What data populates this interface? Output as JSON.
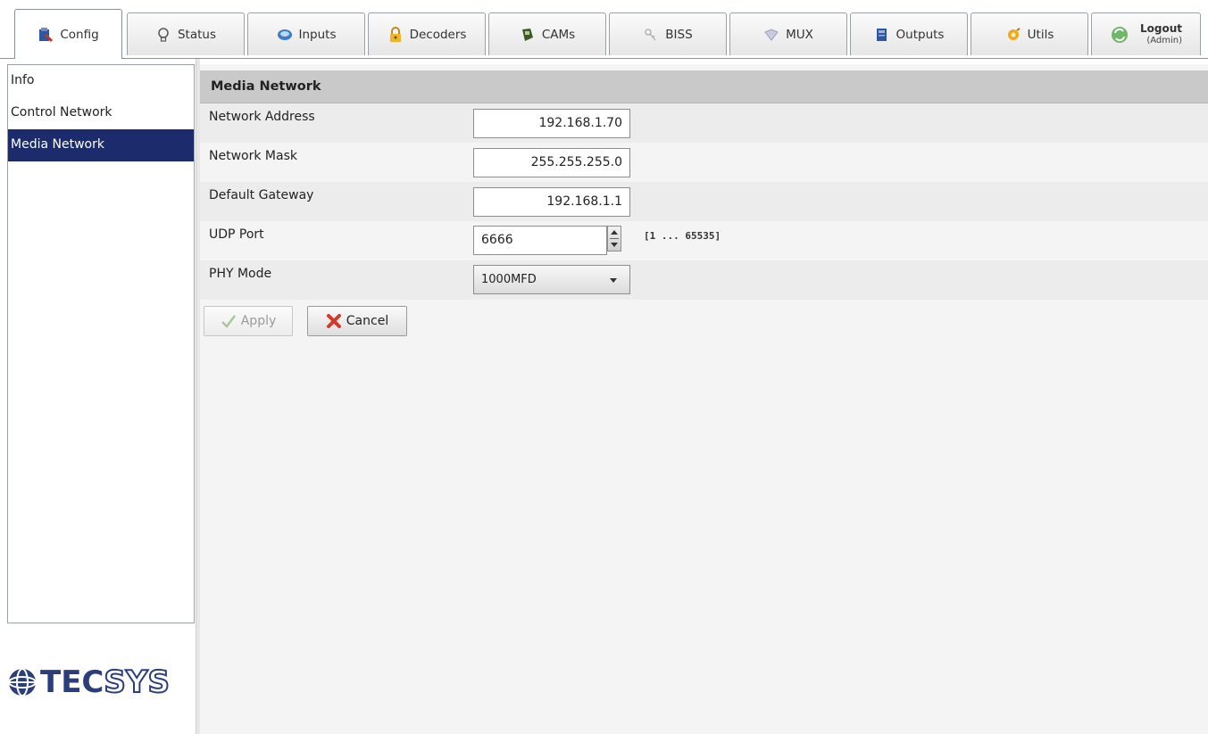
{
  "tabs": [
    {
      "label": "Config",
      "icon": "config-icon",
      "active": true
    },
    {
      "label": "Status",
      "icon": "lightbulb-icon",
      "active": false
    },
    {
      "label": "Inputs",
      "icon": "inputs-icon",
      "active": false
    },
    {
      "label": "Decoders",
      "icon": "lock-icon",
      "active": false
    },
    {
      "label": "CAMs",
      "icon": "cam-icon",
      "active": false
    },
    {
      "label": "BISS",
      "icon": "biss-icon",
      "active": false
    },
    {
      "label": "MUX",
      "icon": "mux-icon",
      "active": false
    },
    {
      "label": "Outputs",
      "icon": "outputs-icon",
      "active": false
    },
    {
      "label": "Utils",
      "icon": "utils-icon",
      "active": false
    }
  ],
  "logout": {
    "label": "Logout",
    "user": "(Admin)"
  },
  "sidebar": {
    "items": [
      {
        "label": "Info",
        "selected": false
      },
      {
        "label": "Control Network",
        "selected": false
      },
      {
        "label": "Media Network",
        "selected": true
      }
    ]
  },
  "logo": {
    "tec": "TEC",
    "sys": "SYS"
  },
  "section": {
    "title": "Media Network"
  },
  "form": {
    "network_address": {
      "label": "Network Address",
      "value": "192.168.1.70"
    },
    "network_mask": {
      "label": "Network Mask",
      "value": "255.255.255.0"
    },
    "default_gateway": {
      "label": "Default Gateway",
      "value": "192.168.1.1"
    },
    "udp_port": {
      "label": "UDP Port",
      "value": "6666",
      "range": "[1 ... 65535]"
    },
    "phy_mode": {
      "label": "PHY Mode",
      "value": "1000MFD"
    }
  },
  "buttons": {
    "apply": "Apply",
    "cancel": "Cancel"
  },
  "colors": {
    "selection": "#1c2b6b",
    "header": "#c9c9c9",
    "logo_blue": "#2a3d7d"
  }
}
